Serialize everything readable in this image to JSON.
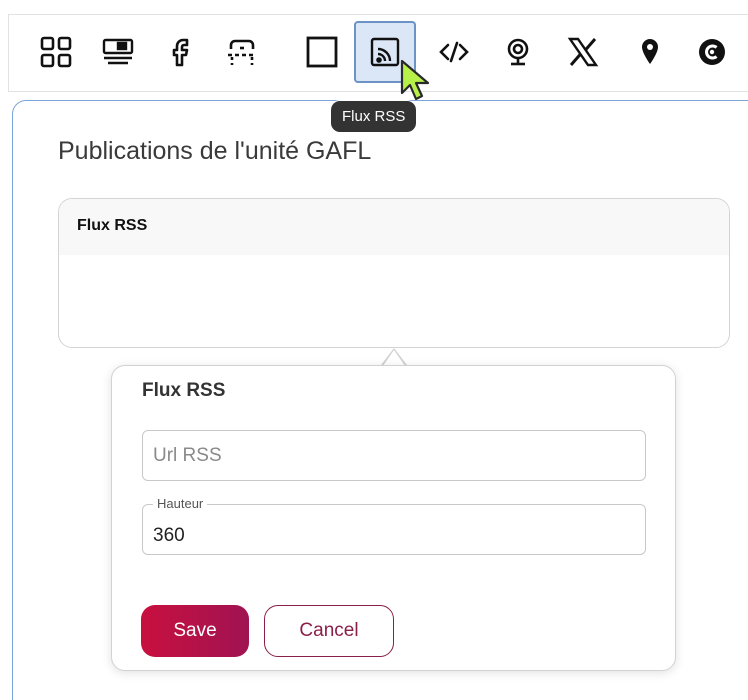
{
  "toolbar": {
    "icons": [
      {
        "name": "grid-icon",
        "active": false
      },
      {
        "name": "server-icon",
        "active": false
      },
      {
        "name": "facebook-icon",
        "active": false
      },
      {
        "name": "dashed-frame-icon",
        "active": false
      },
      {
        "name": "square-icon",
        "active": false
      },
      {
        "name": "rss-icon",
        "active": true
      },
      {
        "name": "code-icon",
        "active": false
      },
      {
        "name": "webcam-icon",
        "active": false
      },
      {
        "name": "x-logo-icon",
        "active": false
      },
      {
        "name": "map-pin-icon",
        "active": false
      },
      {
        "name": "circle-c-icon",
        "active": false
      }
    ],
    "tooltip": "Flux RSS"
  },
  "page": {
    "title": "Publications de l'unité GAFL"
  },
  "widget": {
    "title": "Flux RSS"
  },
  "popover": {
    "title": "Flux RSS",
    "url_placeholder": "Url RSS",
    "url_value": "",
    "height_label": "Hauteur",
    "height_value": "360",
    "save_label": "Save",
    "cancel_label": "Cancel"
  },
  "colors": {
    "accent_blue": "#6c93c6",
    "save_button": "#c8103f",
    "cancel_border": "#8a1f49"
  }
}
